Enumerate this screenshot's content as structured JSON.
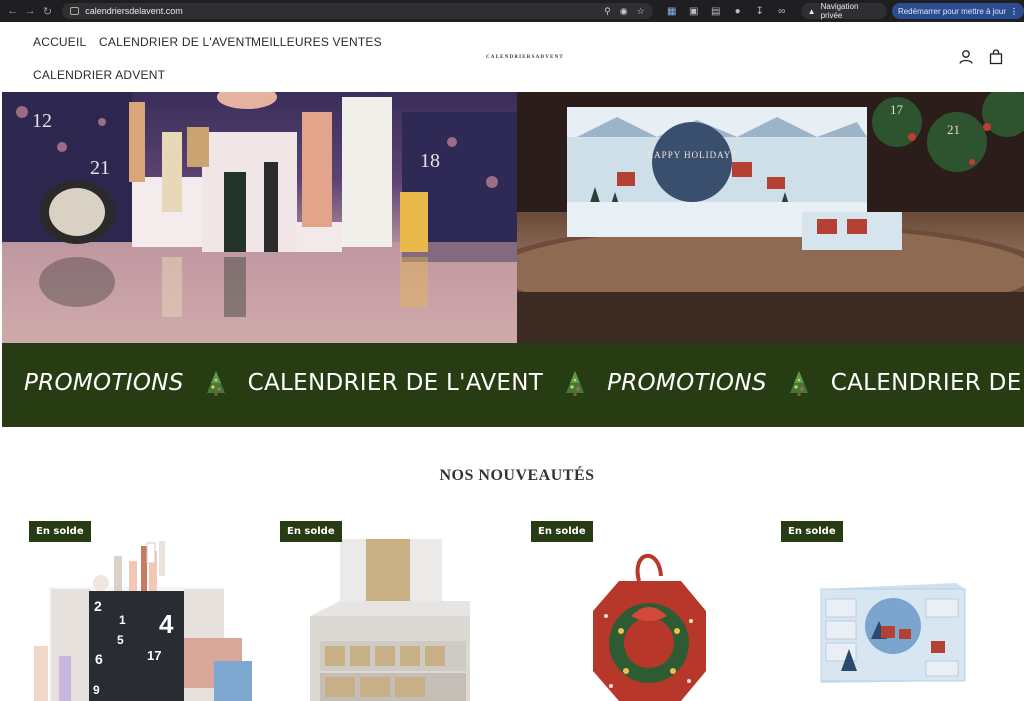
{
  "browser": {
    "url": "calendriersdelavent.com",
    "private_label": "Navigation privée",
    "restart_label": "Redémarrer pour mettre à jour"
  },
  "header": {
    "menu": [
      "ACCUEIL",
      "CALENDRIER DE L'AVENT",
      "MEILLEURES VENTES",
      "CALENDRIER ADVENT"
    ],
    "logo_text": "CALENDRIERSADVENT"
  },
  "hero": {
    "left_numbers": [
      "12",
      "21",
      "18"
    ],
    "right_box_text": "HAPPY HOLIDAYS",
    "right_numbers": [
      "17",
      "21"
    ]
  },
  "marquee": {
    "items": [
      "PROMOTIONS",
      "CALENDRIER DE L'AVENT",
      "PROMOTIONS",
      "CALENDRIER DE L'AV"
    ]
  },
  "section": {
    "title": "NOS NOUVEAUTÉS"
  },
  "products": [
    {
      "badge": "En solde",
      "numbers": [
        "2",
        "1",
        "4",
        "5",
        "6",
        "17",
        "9"
      ]
    },
    {
      "badge": "En solde"
    },
    {
      "badge": "En solde"
    },
    {
      "badge": "En solde"
    }
  ],
  "colors": {
    "accent_green": "#283c13",
    "browser_dark": "#1f1f21",
    "update_blue": "#2b4d8f"
  }
}
